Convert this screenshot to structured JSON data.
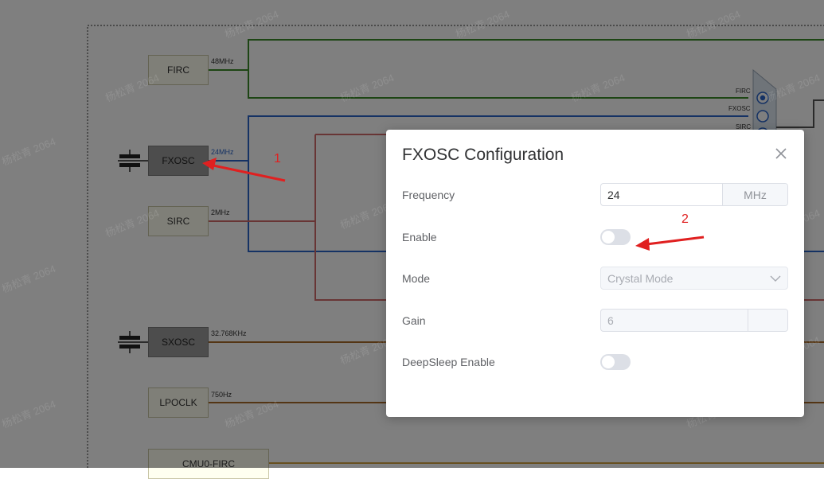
{
  "diagram": {
    "blocks": {
      "firc": "FIRC",
      "fxosc": "FXOSC",
      "sirc": "SIRC",
      "sxosc": "SXOSC",
      "lpoclk": "LPOCLK",
      "cmu0_firc": "CMU0-FIRC"
    },
    "frequencies": {
      "firc": "48MHz",
      "fxosc": "24MHz",
      "sirc": "2MHz",
      "sxosc": "32.768KHz",
      "lpoclk": "750Hz"
    },
    "mux_inputs": [
      "FIRC",
      "FXOSC",
      "SIRC"
    ],
    "colors": {
      "firc_line": "#3a8a28",
      "fxosc_line": "#2a64c8",
      "sirc_line": "#d06a6a",
      "sxosc_line": "#a86a28",
      "lpoclk_line": "#a86a28"
    }
  },
  "watermark": "杨松青 2064",
  "dialog": {
    "title": "FXOSC Configuration",
    "close_icon": "close-icon",
    "frequency": {
      "label": "Frequency",
      "value": "24",
      "unit": "MHz"
    },
    "enable": {
      "label": "Enable",
      "checked": false
    },
    "mode": {
      "label": "Mode",
      "value": "Crystal Mode"
    },
    "gain": {
      "label": "Gain",
      "value": "6"
    },
    "deepsleep": {
      "label": "DeepSleep Enable",
      "checked": false
    }
  },
  "annotations": {
    "arrow1_label": "1",
    "arrow2_label": "2",
    "color": "#e02020"
  }
}
